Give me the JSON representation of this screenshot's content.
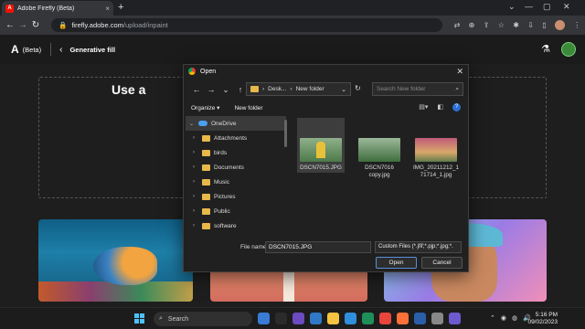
{
  "browser": {
    "tab_title": "Adobe Firefly (Beta)",
    "tab_close": "×",
    "new_tab": "+",
    "url_host": "firefly.adobe.com",
    "url_path": "/upload/inpaint",
    "window_controls": [
      "⌄",
      "—",
      "▢",
      "✕"
    ]
  },
  "app": {
    "logo": "A",
    "beta_label": "(Beta)",
    "back_glyph": "‹",
    "page_title": "Generative fill",
    "hero_text": "Use a"
  },
  "dialog": {
    "title": "Open",
    "close_glyph": "✕",
    "path": [
      "Desk...",
      "New folder"
    ],
    "path_separator": "›",
    "search_placeholder": "Search New folder",
    "toolbar": {
      "organize": "Organize ▾",
      "new_folder": "New folder",
      "help": "?"
    },
    "tree": [
      {
        "label": "OneDrive",
        "type": "cloud",
        "selected": true
      },
      {
        "label": "Attachments",
        "type": "folder"
      },
      {
        "label": "birds",
        "type": "folder"
      },
      {
        "label": "Documents",
        "type": "folder"
      },
      {
        "label": "Music",
        "type": "folder"
      },
      {
        "label": "Pictures",
        "type": "folder"
      },
      {
        "label": "Public",
        "type": "folder"
      },
      {
        "label": "software",
        "type": "folder"
      }
    ],
    "files": [
      {
        "name": "DSCN7015.JPG",
        "selected": true
      },
      {
        "name": "DSCN7016 copy.jpg",
        "selected": false
      },
      {
        "name": "IMG_20211212_171714_1.jpg",
        "selected": false
      }
    ],
    "file_name_label": "File name:",
    "file_name_value": "DSCN7015.JPG",
    "file_type": "Custom Files (*.jfif;*.pjp;*.jpg;*.",
    "open_label": "Open",
    "cancel_label": "Cancel"
  },
  "taskbar": {
    "search_label": "Search",
    "time": "5:16 PM",
    "date": "09/02/2023",
    "apps": [
      "#3a7bd5",
      "#2b2b2b",
      "#6b4bbf",
      "#3178c6",
      "#f5c542",
      "#2f8fdc",
      "#1f8f5a",
      "#e8453c",
      "#ff7139",
      "#2b5ea8",
      "#888888",
      "#6d5acf"
    ],
    "tray": [
      "⌃",
      "◉",
      "◍",
      "🔊"
    ]
  },
  "colors": {
    "accent": "#2c6fd6",
    "selection": "#3d3d3d",
    "folder": "#e8b84a"
  }
}
